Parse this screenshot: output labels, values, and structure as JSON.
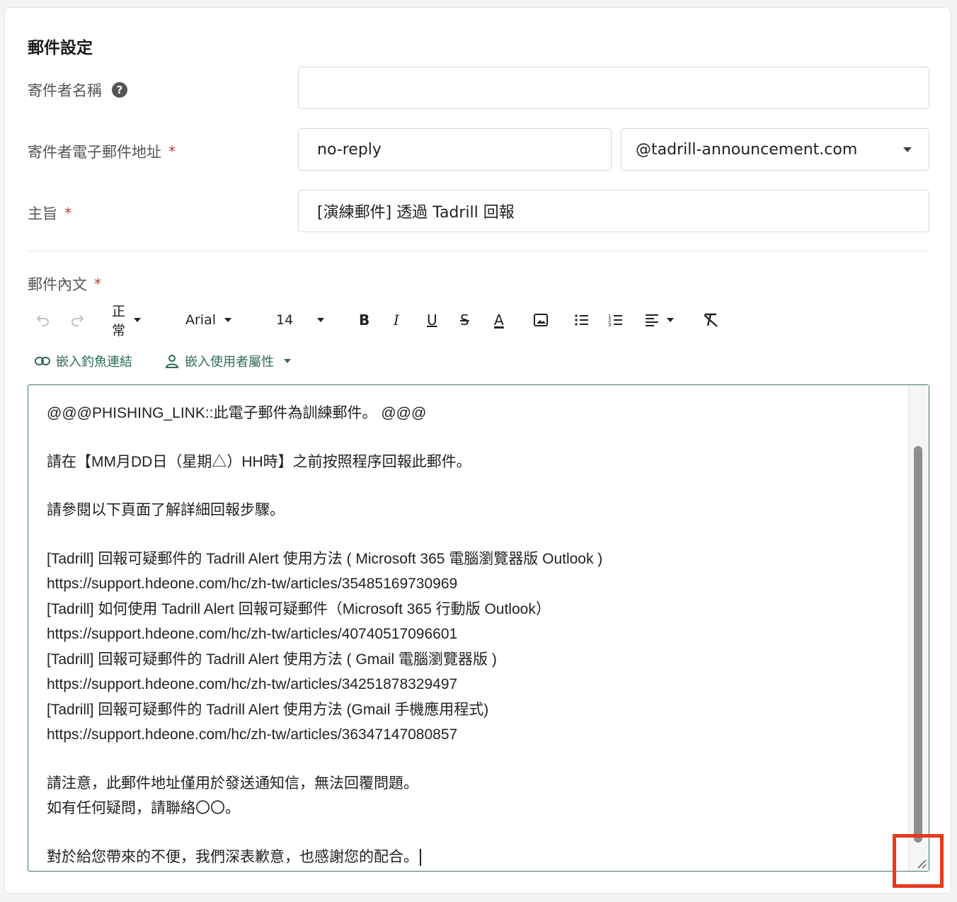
{
  "section": {
    "title": "郵件設定"
  },
  "sender_name": {
    "label": "寄件者名稱",
    "value": ""
  },
  "sender_email": {
    "label": "寄件者電子郵件地址",
    "required_mark": "*",
    "local_part": "no-reply",
    "domain": "@tadrill-announcement.com"
  },
  "subject": {
    "label": "主旨",
    "required_mark": "*",
    "value": "[演練郵件] 透過 Tadrill 回報"
  },
  "body": {
    "label": "郵件內文",
    "required_mark": "*"
  },
  "toolbar": {
    "paragraph_style": "正常",
    "font_family": "Arial",
    "font_size": "14",
    "bold": "B",
    "italic": "I",
    "underline": "U",
    "strikethrough": "S",
    "font_color": "A"
  },
  "insert": {
    "phishing_link": "嵌入釣魚連結",
    "user_attribute": "嵌入使用者屬性"
  },
  "editor_lines": [
    "@@@PHISHING_LINK::此電子郵件為訓練郵件。 @@@",
    "",
    "請在【MM月DD日（星期△）HH時】之前按照程序回報此郵件。",
    "",
    "請參閱以下頁面了解詳細回報步驟。",
    "",
    "[Tadrill] 回報可疑郵件的 Tadrill Alert 使用方法 ( Microsoft 365 電腦瀏覽器版 Outlook )",
    "https://support.hdeone.com/hc/zh-tw/articles/35485169730969",
    "[Tadrill] 如何使用 Tadrill Alert 回報可疑郵件（Microsoft 365 行動版 Outlook）",
    "https://support.hdeone.com/hc/zh-tw/articles/40740517096601",
    "[Tadrill] 回報可疑郵件的 Tadrill Alert 使用方法 ( Gmail 電腦瀏覽器版 )",
    "https://support.hdeone.com/hc/zh-tw/articles/34251878329497",
    "[Tadrill] 回報可疑郵件的 Tadrill Alert 使用方法 (Gmail 手機應用程式)",
    "https://support.hdeone.com/hc/zh-tw/articles/36347147080857",
    "",
    "請注意，此郵件地址僅用於發送通知信，無法回覆問題。",
    "如有任何疑問，請聯絡〇〇。",
    "",
    "對於給您帶來的不便，我們深表歉意，也感謝您的配合。"
  ],
  "colors": {
    "accent": "#2e6b5a",
    "editor_border": "#3f7868",
    "required": "#c0392b",
    "highlight": "#e8391e"
  }
}
